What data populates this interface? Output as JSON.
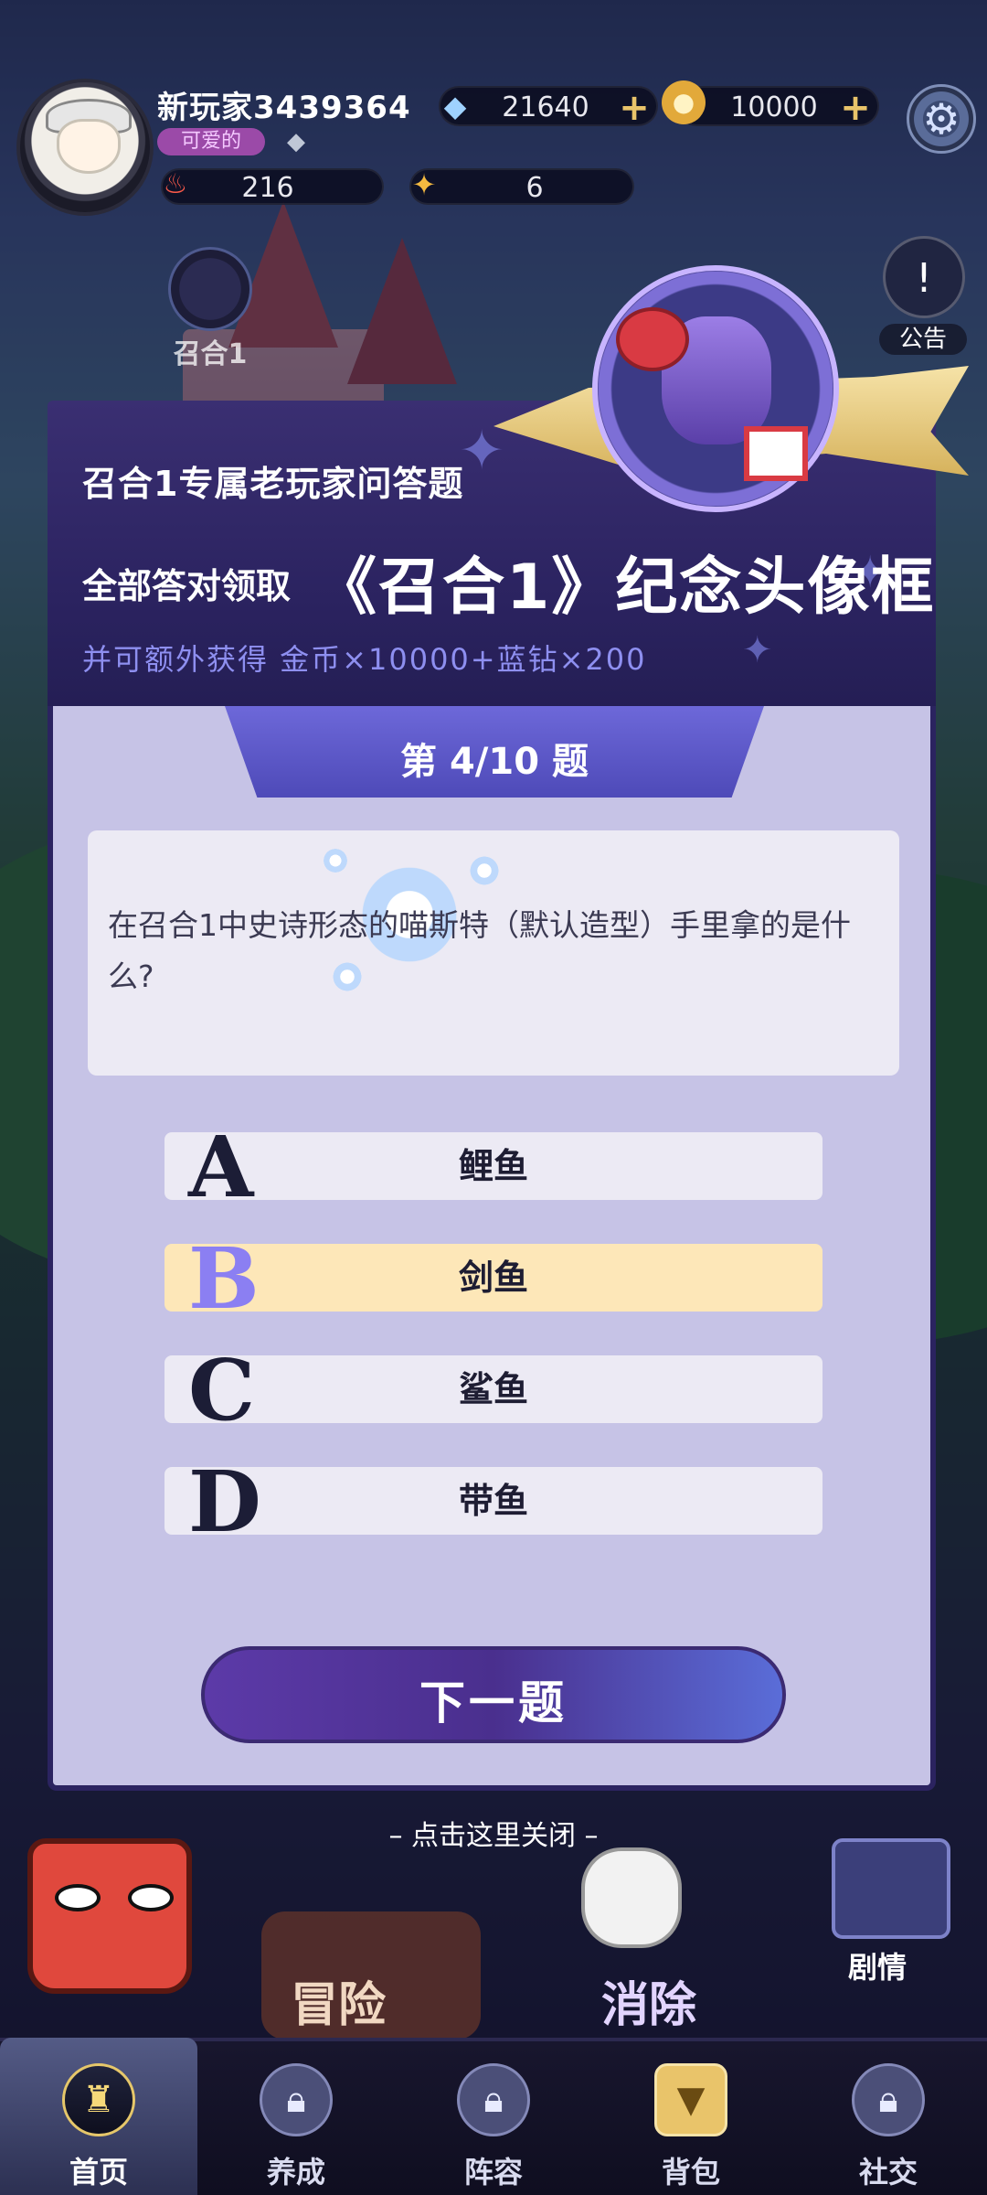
{
  "hud": {
    "player_name": "新玩家3439364",
    "title_tag": "可爱的",
    "diamonds": "21640",
    "coins": "10000",
    "energy": "216",
    "stars": "6",
    "summon_label": "召合1",
    "notice_label": "公告",
    "icons": {
      "diamond": "diamond-icon",
      "coin": "coin-icon",
      "energy": "flame-icon",
      "star": "star-icon",
      "settings": "gear-icon"
    }
  },
  "quiz": {
    "header_line1": "召合1专属老玩家问答题",
    "header_line2_prefix": "全部答对领取",
    "header_line2_reward": "《召合1》纪念头像框",
    "header_line3": "并可额外获得 金币×10000+蓝钻×200",
    "progress_label": "第 4/10 题",
    "question": "在召合1中史诗形态的喵斯特（默认造型）手里拿的是什么?",
    "options": [
      {
        "letter": "A",
        "text": "鲤鱼",
        "selected": false
      },
      {
        "letter": "B",
        "text": "剑鱼",
        "selected": true
      },
      {
        "letter": "C",
        "text": "鲨鱼",
        "selected": false
      },
      {
        "letter": "D",
        "text": "带鱼",
        "selected": false
      }
    ],
    "next_button": "下一题",
    "close_hint": "– 点击这里关闭 –"
  },
  "game": {
    "adventure_label": "冒险",
    "eliminate_label": "消除",
    "story_label": "剧情"
  },
  "nav": [
    {
      "label": "首页",
      "icon": "home-icon",
      "active": true
    },
    {
      "label": "养成",
      "icon": "lock-icon",
      "active": false
    },
    {
      "label": "阵容",
      "icon": "lock-icon",
      "active": false
    },
    {
      "label": "背包",
      "icon": "backpack-icon",
      "active": false
    },
    {
      "label": "社交",
      "icon": "lock-icon",
      "active": false
    }
  ],
  "colors": {
    "dialog_header": "#2b2360",
    "dialog_body": "#c6c3e6",
    "selected_option": "#fde7b8",
    "accent_purple": "#6d68d9",
    "gold": "#e9c46a"
  }
}
